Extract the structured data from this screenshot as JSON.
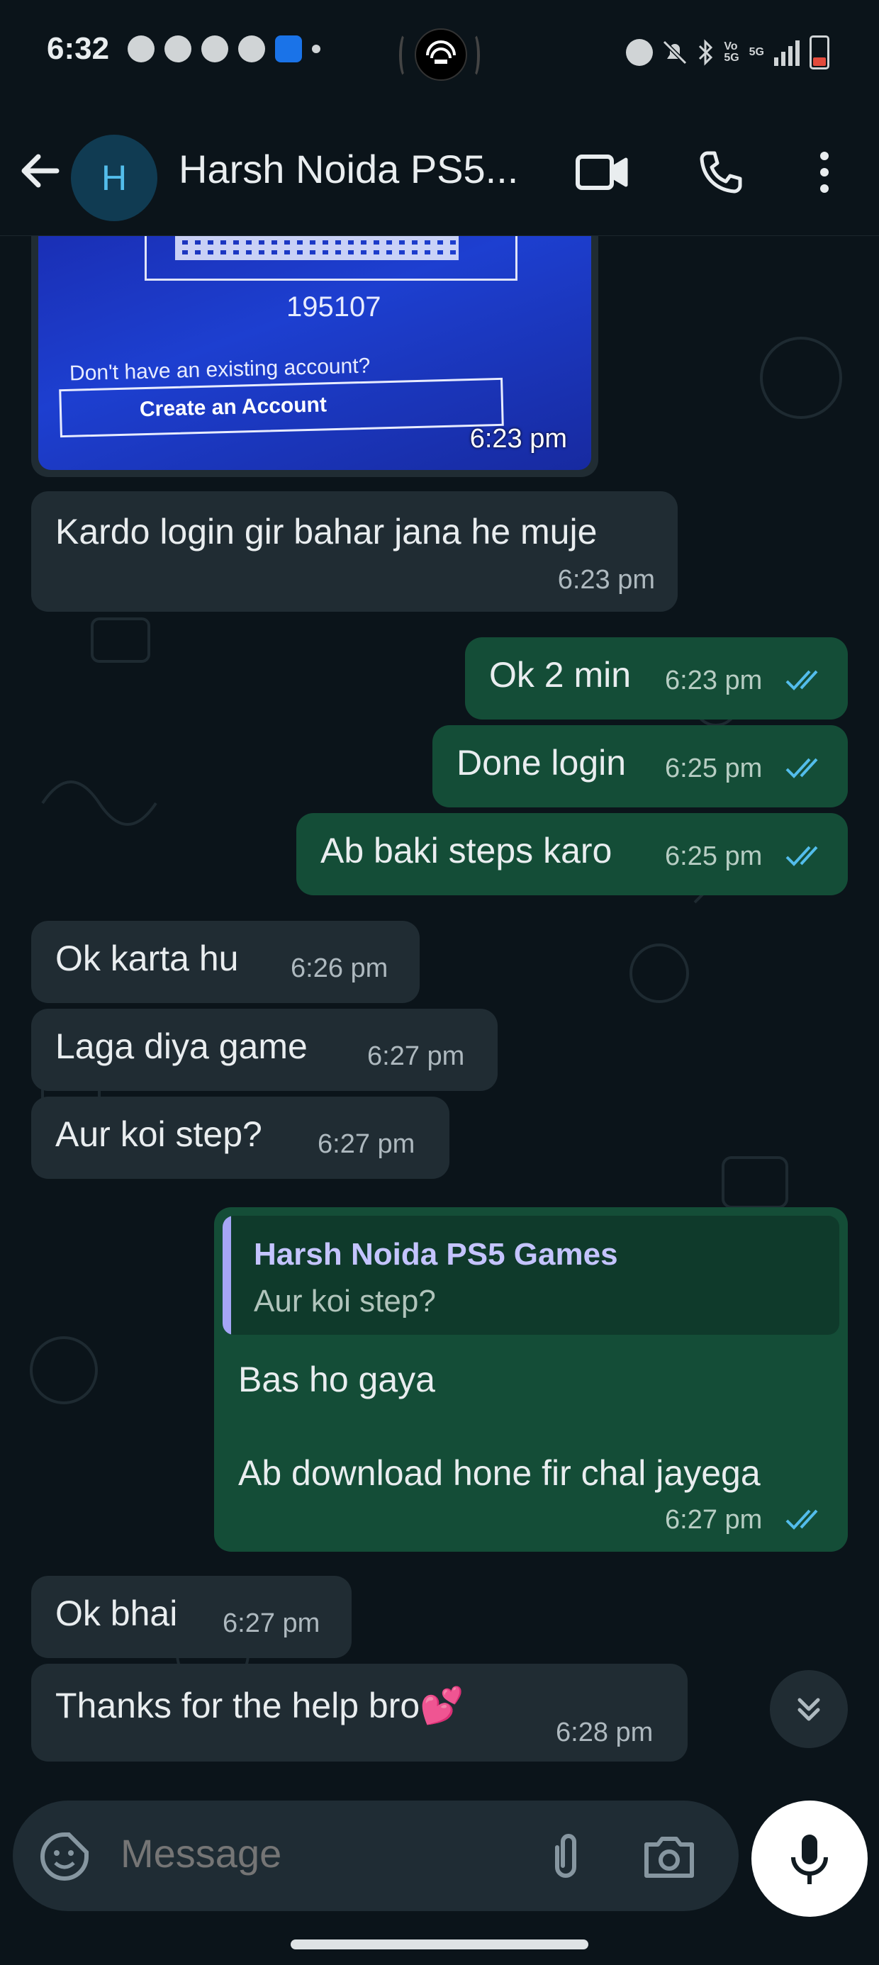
{
  "status_bar": {
    "time": "6:32",
    "network": "5G",
    "volte": "Vo\n5G"
  },
  "header": {
    "avatar_letter": "H",
    "contact_name": "Harsh Noida PS5..."
  },
  "image_message": {
    "code": "195107",
    "question": "Don't have an existing account?",
    "create_account": "Create an Account",
    "time": "6:23 pm"
  },
  "messages": [
    {
      "dir": "in",
      "text": "Kardo login gir bahar jana he muje",
      "time": "6:23 pm"
    },
    {
      "dir": "out",
      "text": "Ok 2 min",
      "time": "6:23 pm"
    },
    {
      "dir": "out",
      "text": "Done login",
      "time": "6:25 pm"
    },
    {
      "dir": "out",
      "text": "Ab baki steps karo",
      "time": "6:25 pm"
    },
    {
      "dir": "in",
      "text": "Ok karta hu",
      "time": "6:26 pm"
    },
    {
      "dir": "in",
      "text": "Laga diya game",
      "time": "6:27 pm"
    },
    {
      "dir": "in",
      "text": "Aur koi step?",
      "time": "6:27 pm"
    }
  ],
  "reply_message": {
    "quoted_name": "Harsh Noida PS5 Games",
    "quoted_text": "Aur koi step?",
    "line1": "Bas ho gaya",
    "line2": "Ab download hone fir chal jayega",
    "time": "6:27 pm"
  },
  "messages_after": [
    {
      "dir": "in",
      "text": "Ok bhai",
      "time": "6:27 pm"
    },
    {
      "dir": "in",
      "text": "Thanks for the help bro💕",
      "time": "6:28 pm"
    }
  ],
  "composer": {
    "placeholder": "Message"
  },
  "colors": {
    "background": "#0b141a",
    "incoming_bubble": "#202c33",
    "outgoing_bubble": "#144d37",
    "read_ticks": "#53bdeb"
  },
  "icons": [
    "back-arrow-icon",
    "video-call-icon",
    "voice-call-icon",
    "more-options-icon",
    "read-ticks-icon",
    "scroll-down-icon",
    "emoji-sticker-icon",
    "attach-icon",
    "camera-icon",
    "mic-icon"
  ]
}
